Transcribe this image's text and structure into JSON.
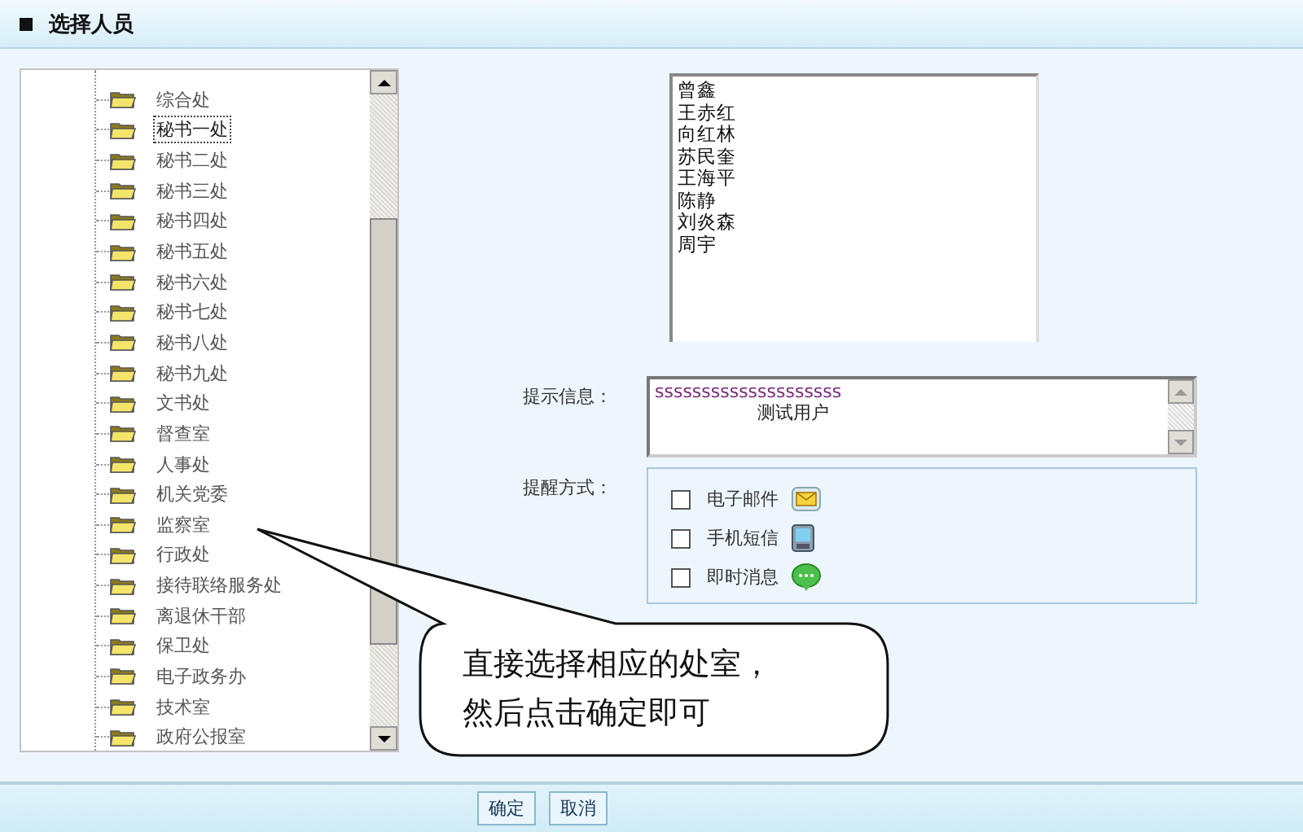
{
  "title": "选择人员",
  "departments": [
    {
      "label": "综合处",
      "selected": false
    },
    {
      "label": "秘书一处",
      "selected": true
    },
    {
      "label": "秘书二处",
      "selected": false
    },
    {
      "label": "秘书三处",
      "selected": false
    },
    {
      "label": "秘书四处",
      "selected": false
    },
    {
      "label": "秘书五处",
      "selected": false
    },
    {
      "label": "秘书六处",
      "selected": false
    },
    {
      "label": "秘书七处",
      "selected": false
    },
    {
      "label": "秘书八处",
      "selected": false
    },
    {
      "label": "秘书九处",
      "selected": false
    },
    {
      "label": "文书处",
      "selected": false
    },
    {
      "label": "督查室",
      "selected": false
    },
    {
      "label": "人事处",
      "selected": false
    },
    {
      "label": "机关党委",
      "selected": false
    },
    {
      "label": "监察室",
      "selected": false
    },
    {
      "label": "行政处",
      "selected": false
    },
    {
      "label": "接待联络服务处",
      "selected": false
    },
    {
      "label": "离退休干部",
      "selected": false
    },
    {
      "label": "保卫处",
      "selected": false
    },
    {
      "label": "电子政务办",
      "selected": false
    },
    {
      "label": "技术室",
      "selected": false
    },
    {
      "label": "政府公报室",
      "selected": false
    }
  ],
  "selected_people": [
    "曾鑫",
    "王赤红",
    "向红林",
    "苏民奎",
    "王海平",
    "陈静",
    "刘炎森",
    "周宇"
  ],
  "message": {
    "label": "提示信息：",
    "line_1": "ssssssssssssssssssss",
    "line_2": "测试用户"
  },
  "reminder": {
    "label": "提醒方式：",
    "options": [
      {
        "label": "电子邮件",
        "kind": "email",
        "checked": false
      },
      {
        "label": "手机短信",
        "kind": "sms",
        "checked": false
      },
      {
        "label": "即时消息",
        "kind": "chat",
        "checked": false
      }
    ]
  },
  "callout": {
    "lines": [
      "直接选择相应的处室，",
      "然后点击确定即可"
    ]
  },
  "buttons": [
    "确定",
    "取消"
  ]
}
